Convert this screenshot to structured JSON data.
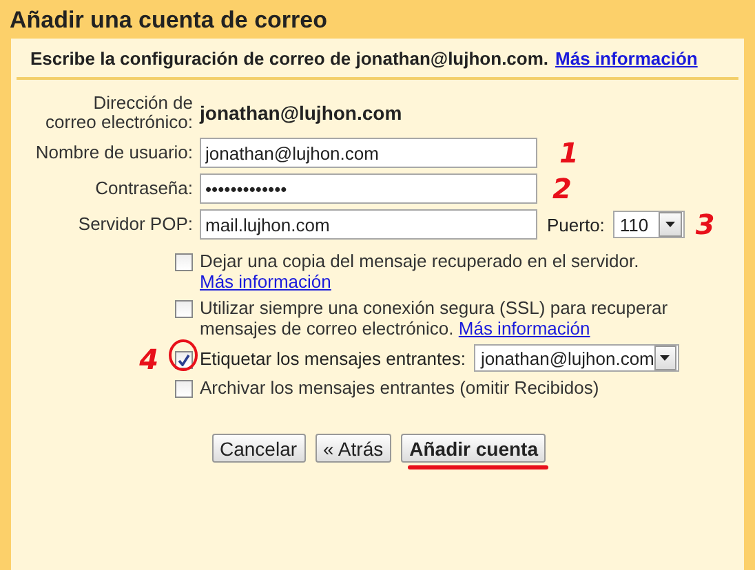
{
  "window": {
    "title": "Añadir una cuenta de correo"
  },
  "intro": {
    "text": "Escribe la configuración de correo de jonathan@lujhon.com.",
    "link": "Más información"
  },
  "email": {
    "label": "Dirección de correo electrónico:",
    "value": "jonathan@lujhon.com"
  },
  "username": {
    "label": "Nombre de usuario:",
    "value": "jonathan@lujhon.com",
    "annotation": "1"
  },
  "password": {
    "label": "Contraseña:",
    "value": "•••••••••••••",
    "annotation": "2"
  },
  "server": {
    "label": "Servidor POP:",
    "value": "mail.lujhon.com",
    "port_label": "Puerto:",
    "port": "110",
    "annotation": "3"
  },
  "options": [
    {
      "kind": "plain",
      "text": "Dejar una copia del mensaje recuperado en el servidor.",
      "link": "Más información",
      "checked": false
    },
    {
      "kind": "plain",
      "text": "Utilizar siempre una conexión segura (SSL) para recuperar mensajes de correo electrónico.",
      "link": "Más información",
      "checked": false
    },
    {
      "kind": "select",
      "text": "Etiquetar los mensajes entrantes:",
      "select": "jonathan@lujhon.com",
      "checked": true,
      "annotation": "4",
      "circled": true
    },
    {
      "kind": "plain",
      "text": "Archivar los mensajes entrantes (omitir Recibidos)",
      "checked": false
    }
  ],
  "buttons": [
    {
      "label": "Cancelar",
      "primary": false,
      "underlined": false
    },
    {
      "label": "« Atrás",
      "primary": false,
      "underlined": false
    },
    {
      "label": "Añadir cuenta",
      "primary": true,
      "underlined": true
    }
  ]
}
